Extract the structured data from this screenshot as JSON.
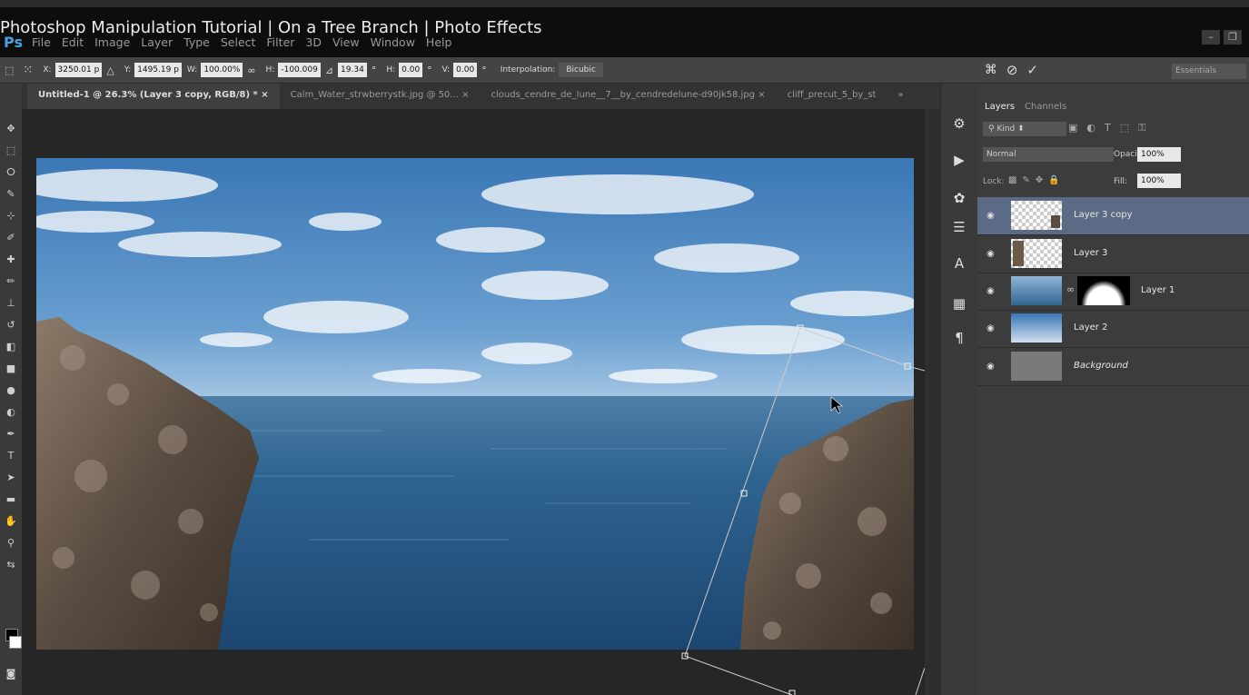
{
  "video_title": "Photoshop Manipulation Tutorial | On a Tree Branch | Photo Effects",
  "app_logo": "Ps",
  "menu": [
    "File",
    "Edit",
    "Image",
    "Layer",
    "Type",
    "Select",
    "Filter",
    "3D",
    "View",
    "Window",
    "Help"
  ],
  "window_controls": [
    "–",
    "❐"
  ],
  "options_bar": {
    "x_label": "X:",
    "x_value": "3250.01 p",
    "delta_icon": "△",
    "y_label": "Y:",
    "y_value": "1495.19 p",
    "w_label": "W:",
    "w_value": "100.00%",
    "link_icon": "∞",
    "h_label": "H:",
    "h_value": "-100.009",
    "angle_icon": "⊿",
    "angle_value": "19.34",
    "degree": "°",
    "hskew_label": "H:",
    "hskew_value": "0.00",
    "vskew_label": "V:",
    "vskew_value": "0.00",
    "interpolation_label": "Interpolation:",
    "interpolation_value": "Bicubic",
    "workspace": "Essentials"
  },
  "tabs": [
    {
      "label": "Untitled-1 @ 26.3% (Layer 3 copy, RGB/8) *",
      "close": "×"
    },
    {
      "label": "Calm_Water_strwberrystk.jpg @ 50...",
      "close": "×"
    },
    {
      "label": "clouds_cendre_de_lune__7__by_cendredelune-d90jk58.jpg",
      "close": "×"
    },
    {
      "label": "cliff_precut_5_by_st",
      "close": ""
    }
  ],
  "tabs_overflow": "»",
  "layers_panel": {
    "tabs": [
      "Layers",
      "Channels"
    ],
    "filter_kind": "Kind",
    "blend_mode": "Normal",
    "opacity_label": "Opacity:",
    "opacity_value": "100%",
    "lock_label": "Lock:",
    "fill_label": "Fill:",
    "fill_value": "100%",
    "layers": [
      {
        "name": "Layer 3 copy",
        "selected": true
      },
      {
        "name": "Layer 3",
        "selected": false
      },
      {
        "name": "Layer 1",
        "selected": false
      },
      {
        "name": "Layer 2",
        "selected": false
      },
      {
        "name": "Background",
        "selected": false
      }
    ]
  },
  "colors": {
    "layer_selected": "#5b6a85",
    "panel_bg": "#3c3c3c",
    "options_bg": "#444444",
    "sky_top": "#3c78b4",
    "sea": "#2a5f8c"
  }
}
